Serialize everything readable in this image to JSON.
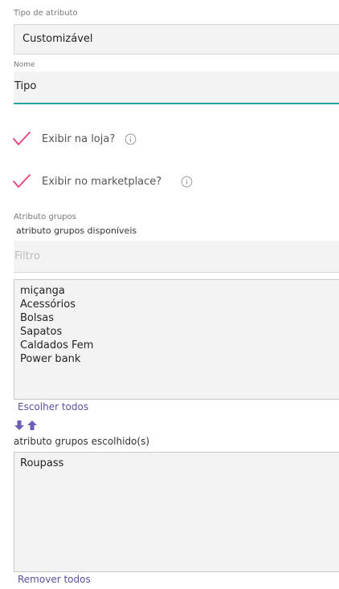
{
  "attribute_type": {
    "label": "Tipo de atributo",
    "value": "Customizável"
  },
  "name_field": {
    "label": "Nome",
    "value": "Tipo"
  },
  "show_in_store": {
    "label": "Exibir na loja?",
    "checked": true
  },
  "show_in_marketplace": {
    "label": "Exibir no marketplace?",
    "checked": true
  },
  "groups": {
    "section_label": "Atributo grupos",
    "available_label": "atributo grupos disponíveis",
    "filter_placeholder": "Filtro",
    "available": [
      "miçanga",
      "Acessórios",
      "Bolsas",
      "Sapatos",
      "Caldados Fem",
      "Power bank"
    ],
    "choose_all": "Escolher todos",
    "chosen_label": "atributo grupos escolhido(s)",
    "chosen": [
      "Roupass"
    ],
    "remove_all": "Remover todos"
  },
  "colors": {
    "accent_check": "#e5417a",
    "underline": "#26a69a",
    "link": "#5a4fa0"
  }
}
